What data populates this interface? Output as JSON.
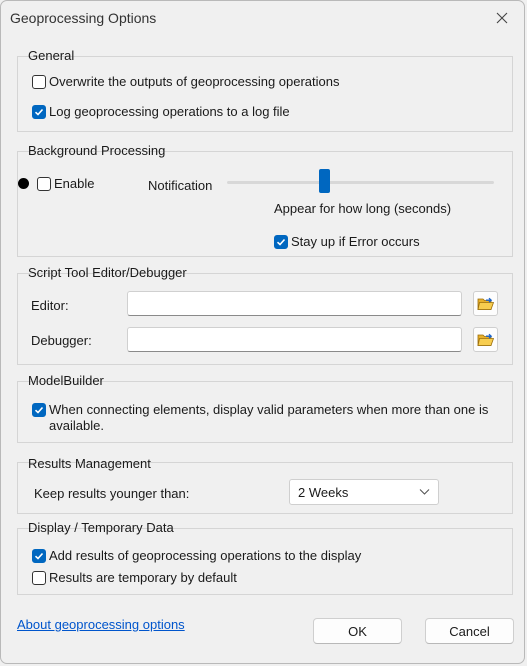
{
  "window": {
    "title": "Geoprocessing Options"
  },
  "general": {
    "title": "General",
    "overwrite": {
      "label": "Overwrite the outputs of geoprocessing operations",
      "checked": false
    },
    "log": {
      "label": "Log geoprocessing operations to a log file",
      "checked": true
    }
  },
  "background": {
    "title": "Background Processing",
    "enable": {
      "label": "Enable",
      "checked": false
    },
    "notification_label": "Notification",
    "slider_caption": "Appear for how long (seconds)",
    "slider_level": 0.36,
    "stay_up": {
      "label": "Stay up if Error occurs",
      "checked": true
    }
  },
  "script_tool": {
    "title": "Script Tool Editor/Debugger",
    "editor_label": "Editor:",
    "editor_value": "",
    "debugger_label": "Debugger:",
    "debugger_value": ""
  },
  "modelbuilder": {
    "title": "ModelBuilder",
    "valid_params": {
      "label_line1": "When connecting elements, display valid parameters when more than one is",
      "label_line2": "available.",
      "checked": true
    }
  },
  "results": {
    "title": "Results Management",
    "keep_label": "Keep results younger than:",
    "keep_value": "2 Weeks"
  },
  "display": {
    "title": "Display / Temporary Data",
    "add_results": {
      "label": "Add results of geoprocessing operations to the display",
      "checked": true
    },
    "temporary": {
      "label": "Results are temporary by default",
      "checked": false
    }
  },
  "footer": {
    "about_link": "About geoprocessing options",
    "ok": "OK",
    "cancel": "Cancel"
  },
  "colors": {
    "accent": "#0067c0",
    "link": "#0055cc"
  },
  "icons": {
    "close": "close-icon",
    "check": "checkmark-icon",
    "folder": "open-folder-icon",
    "chevron": "chevron-down-icon"
  }
}
